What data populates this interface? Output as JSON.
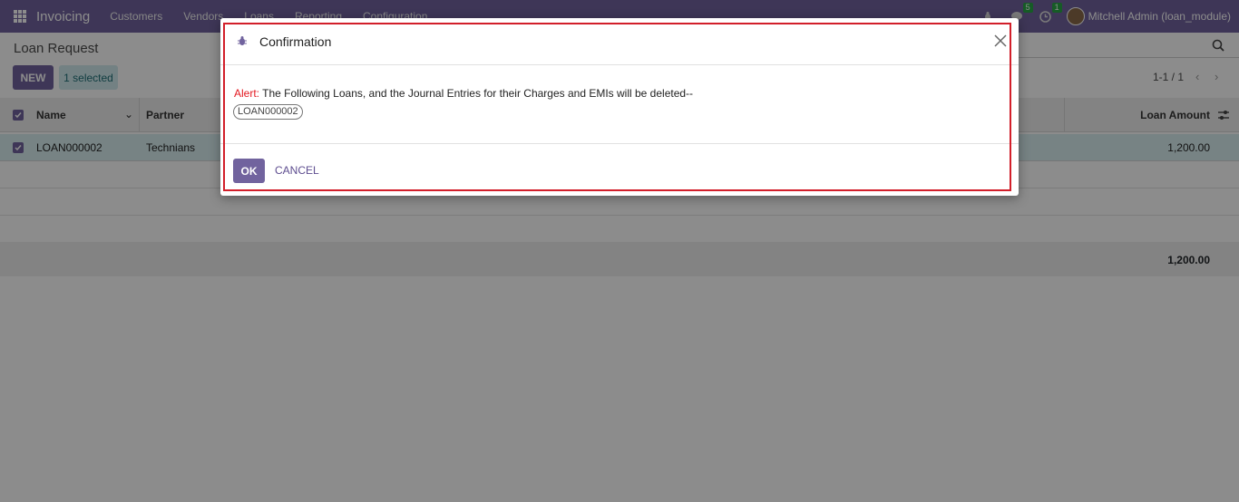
{
  "navbar": {
    "app_name": "Invoicing",
    "menu": [
      "Customers",
      "Vendors",
      "Loans",
      "Reporting",
      "Configuration"
    ],
    "messages_badge": "5",
    "activities_badge": "1",
    "user_name": "Mitchell Admin (loan_module)"
  },
  "control_panel": {
    "title": "Loan Request",
    "new_label": "NEW",
    "selected_label": "1 selected",
    "pager": "1-1 / 1"
  },
  "table": {
    "headers": {
      "name": "Name",
      "partner": "Partner",
      "loan_amount": "Loan Amount"
    },
    "rows": [
      {
        "name": "LOAN000002",
        "partner": "Technians",
        "loan_amount": "1,200.00"
      }
    ],
    "total": "1,200.00"
  },
  "dialog": {
    "title": "Confirmation",
    "alert_label": "Alert:",
    "alert_text": " The Following Loans, and the Journal Entries for their Charges and EMIs will be deleted--",
    "loan_tags": [
      "LOAN000002"
    ],
    "ok_label": "OK",
    "cancel_label": "CANCEL"
  },
  "colors": {
    "brand": "#71639e",
    "highlight": "#d21f2a",
    "alert": "#e3171f"
  }
}
